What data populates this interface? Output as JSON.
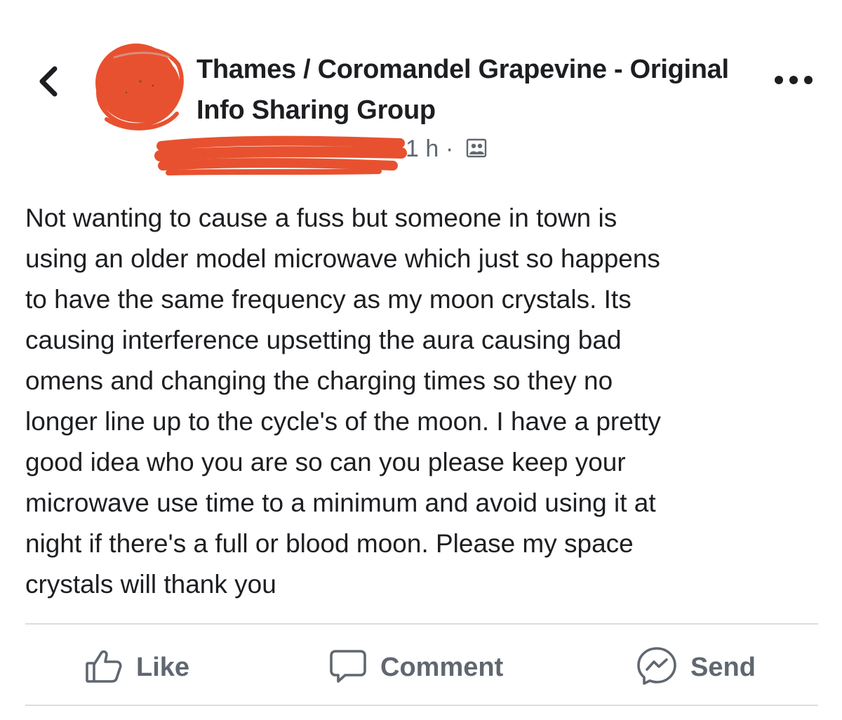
{
  "header": {
    "back_icon": "chevron-left-icon",
    "group_title": "Thames / Coromandel Grapevine - Original Info Sharing Group",
    "more_icon": "more-horizontal-icon",
    "time": "1 h",
    "separator": "·",
    "privacy_icon": "group-members-icon",
    "redaction_color": "#e8512f"
  },
  "post": {
    "lines": [
      "Not wanting to cause a fuss but someone in town is",
      "using an older model microwave which just so happens",
      "to have the same frequency as my moon crystals. Its",
      "causing interference upsetting the aura causing bad",
      "omens and changing the charging times so they no",
      "longer line up to the cycle's of the moon. I have a pretty",
      "good idea who you are so can you please keep your",
      "microwave use time to a minimum and avoid using it at",
      "night if there's a full or blood moon. Please my space",
      "crystals will thank you"
    ]
  },
  "actions": {
    "like_label": "Like",
    "comment_label": "Comment",
    "send_label": "Send",
    "like_icon": "thumbs-up-icon",
    "comment_icon": "comment-bubble-icon",
    "send_icon": "messenger-icon",
    "label_color": "#606770"
  }
}
